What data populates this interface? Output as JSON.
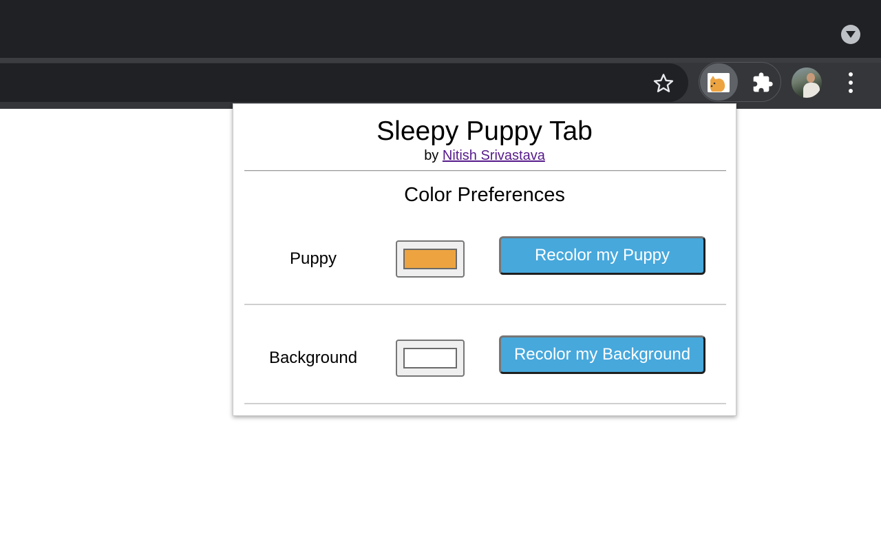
{
  "browser": {
    "tab_search_icon": "chevron-down-icon",
    "bookmark_icon": "star-outline-icon",
    "extension_icon": "sleepy-puppy-extension-icon",
    "extensions_menu_icon": "puzzle-piece-icon",
    "profile_icon": "avatar",
    "menu_icon": "kebab-menu-icon"
  },
  "popup": {
    "title": "Sleepy Puppy Tab",
    "by_prefix": "by",
    "author_link": "Nitish Srivastava",
    "section_title": "Color Preferences",
    "rows": [
      {
        "label": "Puppy",
        "color": "#eda440",
        "button_label": "Recolor my Puppy"
      },
      {
        "label": "Background",
        "color": "#ffffff",
        "button_label": "Recolor my Background"
      }
    ]
  },
  "colors": {
    "button_bg": "#47a8dc",
    "chrome_dark": "#202124",
    "toolbar": "#35363a"
  }
}
